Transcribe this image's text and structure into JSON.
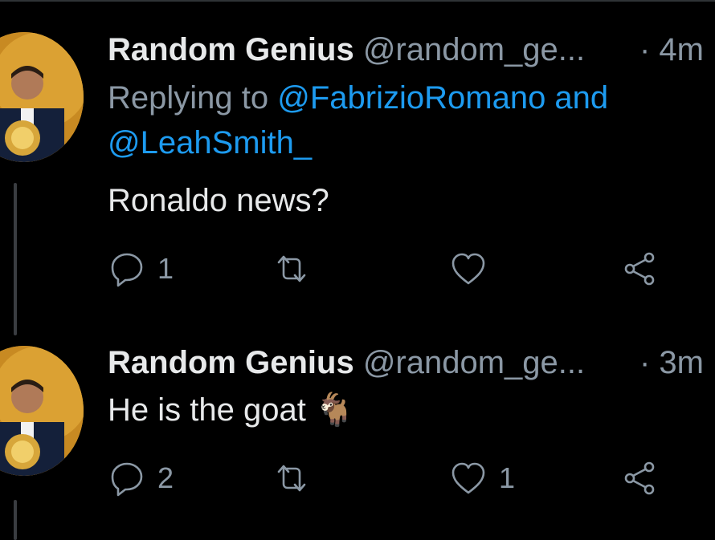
{
  "tweets": [
    {
      "author": "Random Genius",
      "handle": "@random_ge...",
      "time": "· 4m",
      "replying_label": "Replying to",
      "replying_mentions": "@FabrizioRomano and",
      "replying_mentions_2": "@LeahSmith_",
      "text": "Ronaldo news?",
      "replies": "1",
      "retweets": "",
      "likes": ""
    },
    {
      "author": "Random Genius",
      "handle": "@random_ge...",
      "time": "· 3m",
      "text": "He is the goat 🐐",
      "replies": "2",
      "retweets": "",
      "likes": "1"
    }
  ],
  "colors": {
    "background": "#000000",
    "text": "#e7e9ea",
    "muted": "#8b98a5",
    "link": "#1d9bf0"
  },
  "icons": [
    "reply-icon",
    "retweet-icon",
    "like-icon",
    "share-icon"
  ]
}
